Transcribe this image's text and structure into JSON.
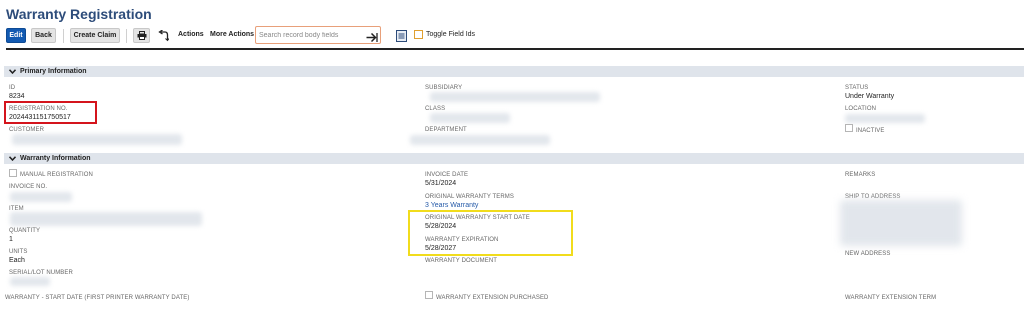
{
  "page": {
    "title": "Warranty Registration"
  },
  "toolbar": {
    "edit_label": "Edit",
    "back_label": "Back",
    "create_claim_label": "Create Claim",
    "actions_label": "Actions",
    "more_actions_label": "More Actions",
    "search_placeholder": "Search record body fields",
    "toggle_field_ids_label": "Toggle Field Ids"
  },
  "sections": {
    "primary": {
      "title": "Primary Information",
      "id_label": "ID",
      "id_value": "8234",
      "registration_no_label": "REGISTRATION NO.",
      "registration_no_value": "2024431151750517",
      "customer_label": "CUSTOMER",
      "subsidiary_label": "SUBSIDIARY",
      "class_label": "CLASS",
      "department_label": "DEPARTMENT",
      "status_label": "STATUS",
      "status_value": "Under Warranty",
      "location_label": "LOCATION",
      "inactive_label": "INACTIVE"
    },
    "warranty": {
      "title": "Warranty Information",
      "manual_registration_label": "MANUAL REGISTRATION",
      "invoice_no_label": "INVOICE NO.",
      "item_label": "ITEM",
      "quantity_label": "QUANTITY",
      "quantity_value": "1",
      "units_label": "UNITS",
      "units_value": "Each",
      "serial_lot_label": "SERIAL/LOT NUMBER",
      "warranty_start_printer_label": "WARRANTY - START DATE (FIRST PRINTER WARRANTY DATE)",
      "invoice_date_label": "INVOICE DATE",
      "invoice_date_value": "5/31/2024",
      "original_terms_label": "ORIGINAL WARRANTY TERMS",
      "original_terms_value": "3 Years Warranty",
      "original_start_label": "ORIGINAL WARRANTY START DATE",
      "original_start_value": "5/28/2024",
      "expiration_label": "WARRANTY EXPIRATION",
      "expiration_value": "5/28/2027",
      "warranty_document_label": "WARRANTY DOCUMENT",
      "extension_purchased_label": "WARRANTY EXTENSION PURCHASED",
      "remarks_label": "REMARKS",
      "ship_to_label": "SHIP TO ADDRESS",
      "new_address_label": "NEW ADDRESS",
      "extension_term_label": "WARRANTY EXTENSION TERM"
    }
  },
  "colors": {
    "title": "#2d4c7a",
    "primary_button": "#125ab2",
    "section_bar": "#dfe4eb",
    "highlight_red": "#d4141c",
    "highlight_yellow": "#f1dc1c",
    "link": "#255aa8"
  },
  "icons": [
    "print-icon",
    "undo-icon",
    "search-arrow-icon",
    "field-ids-icon",
    "chevron-down-icon"
  ]
}
